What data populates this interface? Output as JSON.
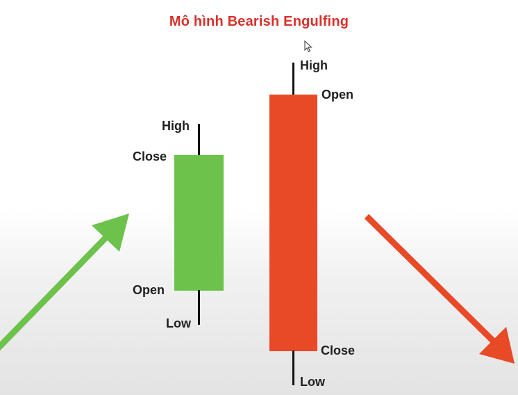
{
  "title": "Mô hình Bearish Engulfing",
  "colors": {
    "title": "#d9302a",
    "bullish": "#6cc24a",
    "bearish": "#e84a27",
    "wick": "#111111",
    "label": "#1f1f1f"
  },
  "bullish_candle": {
    "high_label": "High",
    "close_label": "Close",
    "open_label": "Open",
    "low_label": "Low"
  },
  "bearish_candle": {
    "high_label": "High",
    "open_label": "Open",
    "close_label": "Close",
    "low_label": "Low"
  },
  "icons": {
    "up_arrow": "green-up-trend-arrow",
    "down_arrow": "red-down-trend-arrow",
    "cursor": "mouse-cursor"
  }
}
